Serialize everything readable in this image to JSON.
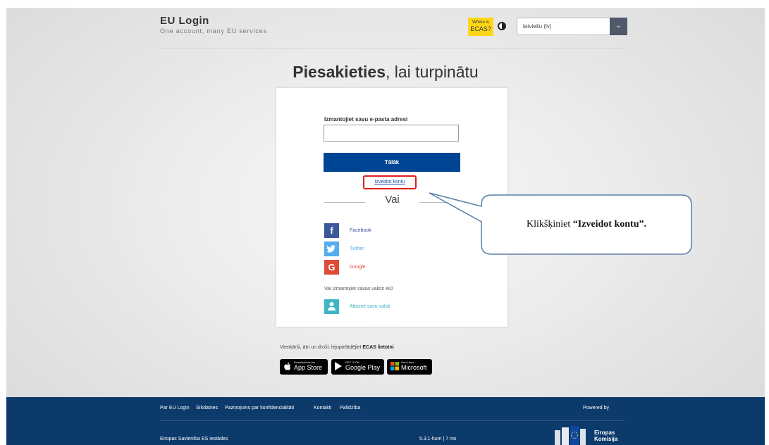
{
  "header": {
    "brand_title": "EU Login",
    "brand_subtitle": "One account, many EU services",
    "where_ecas_line1": "Where is",
    "where_ecas_line2": "ECAS?",
    "language_selected": "latviešu (lv)"
  },
  "heading": {
    "bold": "Piesakieties",
    "rest": ", lai turpinātu"
  },
  "login_card": {
    "email_label": "Izmantojiet savu e-pasta adresi",
    "email_value": "",
    "next_button": "Tālāk",
    "create_account_link": "Izveidot kontu",
    "or_text": "Vai",
    "social": [
      {
        "label": "Facebook",
        "icon": "facebook-icon",
        "color": "#3b5998",
        "label_color": "#3b5998",
        "glyph": "f"
      },
      {
        "label": "Twitter",
        "icon": "twitter-icon",
        "color": "#55acee",
        "label_color": "#55acee",
        "glyph": "🐦"
      },
      {
        "label": "Google",
        "icon": "google-icon",
        "color": "#dd4b39",
        "label_color": "#dd4b39",
        "glyph": "G"
      }
    ],
    "eid_text": "Vai izmantojiet savas valsts eID",
    "choose_country": "Atlasiet savu valsti",
    "choose_country_color": "#3fb6c6"
  },
  "apps": {
    "text_prefix": "Vienkārši, ātri un droši: lejupielādējiet",
    "text_bold": "ECAS lietotni",
    "badges": [
      {
        "small": "Download on the",
        "big": "App Store",
        "icon": "apple-icon"
      },
      {
        "small": "GET IT ON",
        "big": "Google Play",
        "icon": "google-play-icon"
      },
      {
        "small": "Get it from",
        "big": "Microsoft",
        "icon": "microsoft-icon"
      }
    ]
  },
  "callout": {
    "prefix": "Klikšķiniet ",
    "bold": "“Izveidot kontu”."
  },
  "footer": {
    "links": [
      "Par EU Login",
      "Sīkdatnes",
      "Paziņojums par konfidencialitāti",
      "Kontakti",
      "Palīdzība"
    ],
    "bottom_links": [
      "Eiropas Savienība",
      "ES iestādes"
    ],
    "version": "5.3.1-hum | 7 ms",
    "powered_by": "Powered by",
    "ec_name_line1": "Eiropas",
    "ec_name_line2": "Komisija"
  },
  "colors": {
    "primary_button": "#004494",
    "footer_bg": "#0b3a6b",
    "ecas_yellow": "#ffd617",
    "highlight_red": "#e01c1c"
  }
}
